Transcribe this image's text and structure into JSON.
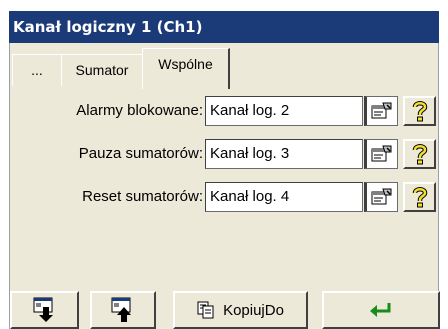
{
  "window": {
    "title": "Kanał logiczny 1 (Ch1)",
    "title_bg": "#1a3a78"
  },
  "tabs": [
    {
      "label": "...",
      "active": false
    },
    {
      "label": "Sumator",
      "active": false
    },
    {
      "label": "Wspólne",
      "active": true
    }
  ],
  "fields": [
    {
      "label": "Alarmy blokowane:",
      "value": "Kanał log. 2",
      "edit_icon": "properties-icon",
      "help_icon": "question-mark-icon"
    },
    {
      "label": "Pauza sumatorów:",
      "value": "Kanał log. 3",
      "edit_icon": "properties-icon",
      "help_icon": "question-mark-icon"
    },
    {
      "label": "Reset sumatorów:",
      "value": "Kanał log. 4",
      "edit_icon": "properties-icon",
      "help_icon": "question-mark-icon"
    }
  ],
  "bottom_buttons": {
    "save_down_icon": "save-down-icon",
    "load_up_icon": "load-up-icon",
    "copy_to_label": "KopiujDo",
    "copy_icon": "copy-icon",
    "enter_icon": "enter-arrow-icon"
  },
  "colors": {
    "help_icon_yellow": "#f4e02a",
    "enter_green": "#1a8c1a"
  }
}
